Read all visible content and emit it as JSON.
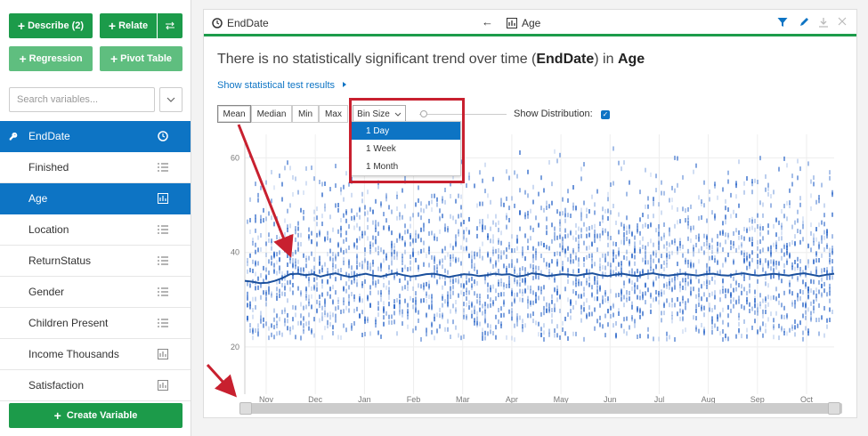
{
  "sidebar": {
    "describe_label": "Describe (2)",
    "relate_label": "Relate",
    "regression_label": "Regression",
    "pivot_label": "Pivot Table",
    "search_placeholder": "Search variables...",
    "variables": [
      {
        "label": "EndDate",
        "icon": "clock-icon",
        "state": "key-selected"
      },
      {
        "label": "Finished",
        "icon": "list-icon",
        "state": "normal"
      },
      {
        "label": "Age",
        "icon": "bar-chart-icon",
        "state": "selected"
      },
      {
        "label": "Location",
        "icon": "list-icon",
        "state": "normal"
      },
      {
        "label": "ReturnStatus",
        "icon": "list-icon",
        "state": "normal"
      },
      {
        "label": "Gender",
        "icon": "list-icon",
        "state": "normal"
      },
      {
        "label": "Children Present",
        "icon": "list-icon",
        "state": "normal"
      },
      {
        "label": "Income Thousands",
        "icon": "bar-chart-icon",
        "state": "normal"
      },
      {
        "label": "Satisfaction",
        "icon": "bar-chart-icon",
        "state": "normal"
      }
    ],
    "create_label": "Create Variable"
  },
  "panel": {
    "left_var": "EndDate",
    "arrow": "←",
    "right_var": "Age",
    "headline_pre": "There is no statistically significant trend over time (",
    "headline_var1": "EndDate",
    "headline_mid": ") in ",
    "headline_var2": "Age",
    "stat_link": "Show statistical test results",
    "stat_buttons": [
      "Mean",
      "Median",
      "Min",
      "Max"
    ],
    "active_stat": "Mean",
    "bin_size_label": "Bin Size",
    "bin_options": [
      "1 Day",
      "1 Week",
      "1 Month"
    ],
    "active_bin": "1 Day",
    "show_distribution_label": "Show Distribution:",
    "show_distribution_checked": true
  },
  "colors": {
    "accent_green": "#1c9b4a",
    "accent_blue": "#0d74c4",
    "annotation_red": "#c8202f"
  },
  "chart_data": {
    "type": "line",
    "y_ticks": [
      "60",
      "40",
      "20"
    ],
    "x_ticks": [
      "Nov",
      "Dec",
      "Jan",
      "Feb",
      "Mar",
      "Apr",
      "May",
      "Jun",
      "Jul",
      "Aug",
      "Sep",
      "Oct"
    ],
    "ylim": [
      10,
      65
    ],
    "series": [
      {
        "values": [
          34,
          33.8,
          33.5,
          33.6,
          34,
          34.6,
          35.4,
          35.5,
          35.2,
          35.4,
          34.9,
          35.3,
          35.6,
          35.1,
          34.8,
          35.2,
          35.5,
          35.1,
          34.9,
          35.3,
          35.6,
          35.2,
          34.9,
          35.1,
          35.4,
          35.5,
          35.2,
          34.8,
          35.1,
          35.4,
          35.3,
          35,
          35.2,
          35.5,
          35.3,
          35.4,
          34.9,
          35.1,
          35.6,
          35.4,
          35,
          35.2,
          35.4,
          35.3,
          35.1,
          35.4,
          35.6,
          35.2,
          35,
          35.3,
          35.5,
          35.2,
          35,
          35.4,
          35.6,
          35.3,
          35.1,
          35.3,
          35.5,
          35.3,
          35.1,
          35.4,
          35.5,
          35.2,
          35.1,
          35.4,
          35.6,
          35.3,
          35.1,
          35.3,
          35.5,
          35.3,
          35.1,
          35.4,
          35.6,
          35.3,
          35,
          35.3,
          35.5
        ]
      }
    ],
    "distribution_shown": true
  }
}
